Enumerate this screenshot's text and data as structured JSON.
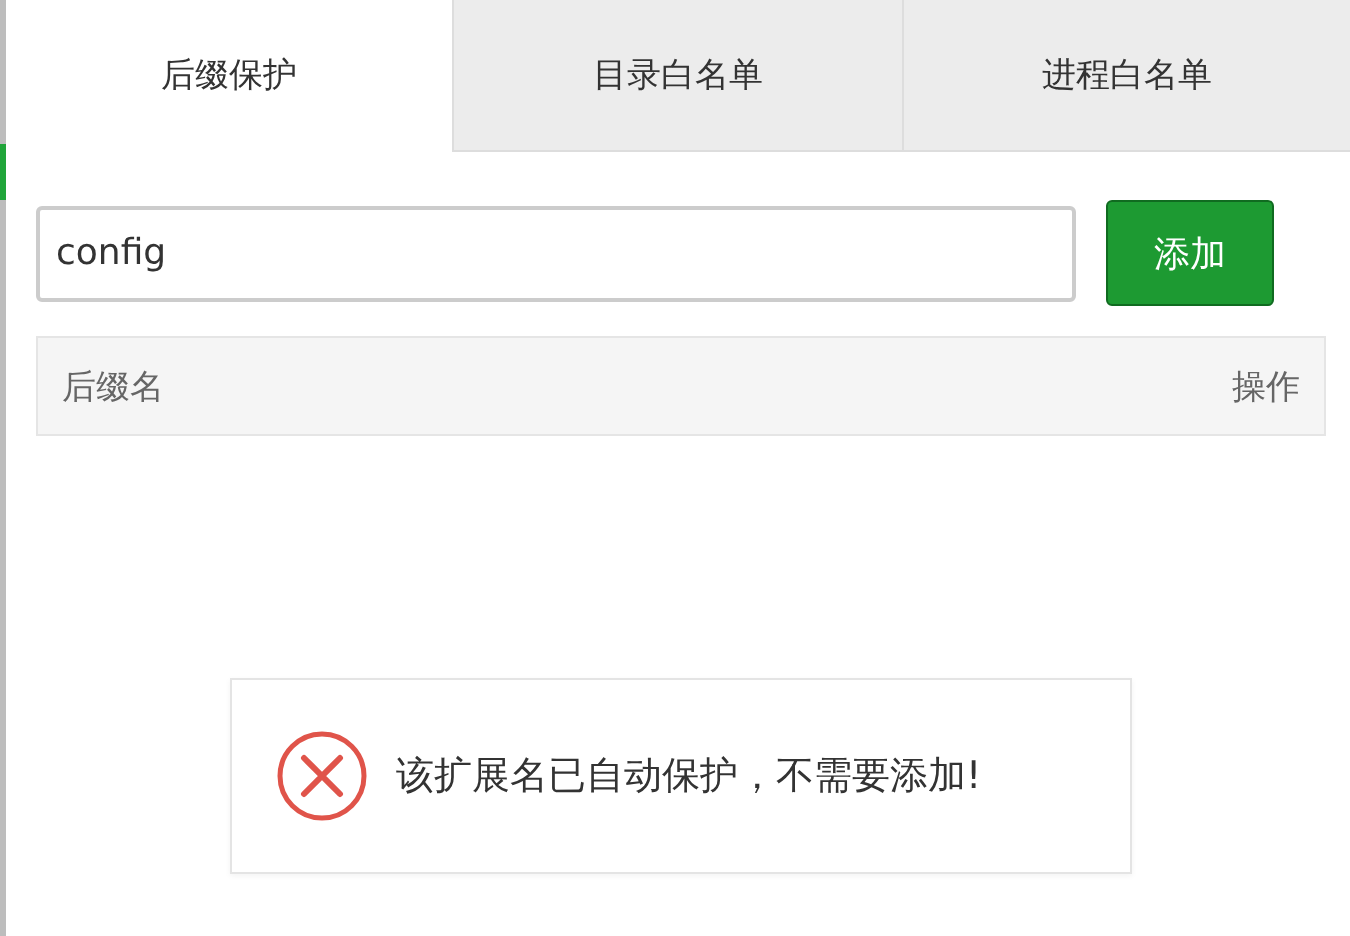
{
  "tabs": [
    {
      "label": "后缀保护",
      "selected": true
    },
    {
      "label": "目录白名单",
      "selected": false
    },
    {
      "label": "进程白名单",
      "selected": false
    }
  ],
  "input": {
    "value": "config"
  },
  "add_button": "添加",
  "table": {
    "columns": [
      "后缀名",
      "操作"
    ]
  },
  "toast": {
    "kind": "error",
    "message": "该扩展名已自动保护，不需要添加!"
  }
}
